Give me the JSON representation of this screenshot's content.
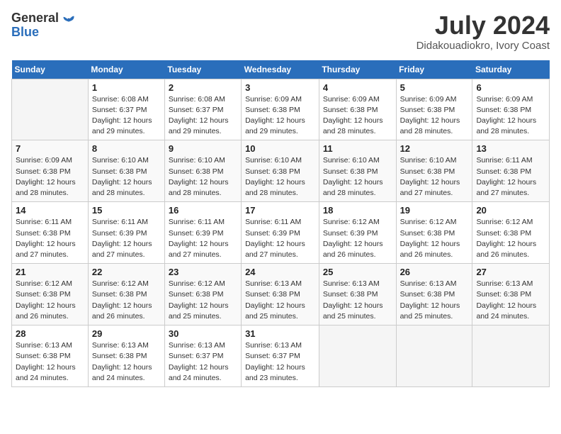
{
  "header": {
    "logo_general": "General",
    "logo_blue": "Blue",
    "title": "July 2024",
    "subtitle": "Didakouadiokro, Ivory Coast"
  },
  "days_of_week": [
    "Sunday",
    "Monday",
    "Tuesday",
    "Wednesday",
    "Thursday",
    "Friday",
    "Saturday"
  ],
  "weeks": [
    [
      {
        "day": "",
        "info": ""
      },
      {
        "day": "1",
        "info": "Sunrise: 6:08 AM\nSunset: 6:37 PM\nDaylight: 12 hours\nand 29 minutes."
      },
      {
        "day": "2",
        "info": "Sunrise: 6:08 AM\nSunset: 6:37 PM\nDaylight: 12 hours\nand 29 minutes."
      },
      {
        "day": "3",
        "info": "Sunrise: 6:09 AM\nSunset: 6:38 PM\nDaylight: 12 hours\nand 29 minutes."
      },
      {
        "day": "4",
        "info": "Sunrise: 6:09 AM\nSunset: 6:38 PM\nDaylight: 12 hours\nand 28 minutes."
      },
      {
        "day": "5",
        "info": "Sunrise: 6:09 AM\nSunset: 6:38 PM\nDaylight: 12 hours\nand 28 minutes."
      },
      {
        "day": "6",
        "info": "Sunrise: 6:09 AM\nSunset: 6:38 PM\nDaylight: 12 hours\nand 28 minutes."
      }
    ],
    [
      {
        "day": "7",
        "info": ""
      },
      {
        "day": "8",
        "info": "Sunrise: 6:10 AM\nSunset: 6:38 PM\nDaylight: 12 hours\nand 28 minutes."
      },
      {
        "day": "9",
        "info": "Sunrise: 6:10 AM\nSunset: 6:38 PM\nDaylight: 12 hours\nand 28 minutes."
      },
      {
        "day": "10",
        "info": "Sunrise: 6:10 AM\nSunset: 6:38 PM\nDaylight: 12 hours\nand 28 minutes."
      },
      {
        "day": "11",
        "info": "Sunrise: 6:10 AM\nSunset: 6:38 PM\nDaylight: 12 hours\nand 28 minutes."
      },
      {
        "day": "12",
        "info": "Sunrise: 6:10 AM\nSunset: 6:38 PM\nDaylight: 12 hours\nand 27 minutes."
      },
      {
        "day": "13",
        "info": "Sunrise: 6:11 AM\nSunset: 6:38 PM\nDaylight: 12 hours\nand 27 minutes."
      }
    ],
    [
      {
        "day": "14",
        "info": ""
      },
      {
        "day": "15",
        "info": "Sunrise: 6:11 AM\nSunset: 6:39 PM\nDaylight: 12 hours\nand 27 minutes."
      },
      {
        "day": "16",
        "info": "Sunrise: 6:11 AM\nSunset: 6:39 PM\nDaylight: 12 hours\nand 27 minutes."
      },
      {
        "day": "17",
        "info": "Sunrise: 6:11 AM\nSunset: 6:39 PM\nDaylight: 12 hours\nand 27 minutes."
      },
      {
        "day": "18",
        "info": "Sunrise: 6:12 AM\nSunset: 6:39 PM\nDaylight: 12 hours\nand 26 minutes."
      },
      {
        "day": "19",
        "info": "Sunrise: 6:12 AM\nSunset: 6:38 PM\nDaylight: 12 hours\nand 26 minutes."
      },
      {
        "day": "20",
        "info": "Sunrise: 6:12 AM\nSunset: 6:38 PM\nDaylight: 12 hours\nand 26 minutes."
      }
    ],
    [
      {
        "day": "21",
        "info": ""
      },
      {
        "day": "22",
        "info": "Sunrise: 6:12 AM\nSunset: 6:38 PM\nDaylight: 12 hours\nand 26 minutes."
      },
      {
        "day": "23",
        "info": "Sunrise: 6:12 AM\nSunset: 6:38 PM\nDaylight: 12 hours\nand 25 minutes."
      },
      {
        "day": "24",
        "info": "Sunrise: 6:13 AM\nSunset: 6:38 PM\nDaylight: 12 hours\nand 25 minutes."
      },
      {
        "day": "25",
        "info": "Sunrise: 6:13 AM\nSunset: 6:38 PM\nDaylight: 12 hours\nand 25 minutes."
      },
      {
        "day": "26",
        "info": "Sunrise: 6:13 AM\nSunset: 6:38 PM\nDaylight: 12 hours\nand 25 minutes."
      },
      {
        "day": "27",
        "info": "Sunrise: 6:13 AM\nSunset: 6:38 PM\nDaylight: 12 hours\nand 24 minutes."
      }
    ],
    [
      {
        "day": "28",
        "info": "Sunrise: 6:13 AM\nSunset: 6:38 PM\nDaylight: 12 hours\nand 24 minutes."
      },
      {
        "day": "29",
        "info": "Sunrise: 6:13 AM\nSunset: 6:38 PM\nDaylight: 12 hours\nand 24 minutes."
      },
      {
        "day": "30",
        "info": "Sunrise: 6:13 AM\nSunset: 6:37 PM\nDaylight: 12 hours\nand 24 minutes."
      },
      {
        "day": "31",
        "info": "Sunrise: 6:13 AM\nSunset: 6:37 PM\nDaylight: 12 hours\nand 23 minutes."
      },
      {
        "day": "",
        "info": ""
      },
      {
        "day": "",
        "info": ""
      },
      {
        "day": "",
        "info": ""
      }
    ]
  ],
  "week7_sunday_info": "Sunrise: 6:09 AM\nSunset: 6:38 PM\nDaylight: 12 hours\nand 28 minutes.",
  "week14_sunday_info": "Sunrise: 6:11 AM\nSunset: 6:38 PM\nDaylight: 12 hours\nand 27 minutes.",
  "week21_sunday_info": "Sunrise: 6:12 AM\nSunset: 6:38 PM\nDaylight: 12 hours\nand 26 minutes."
}
